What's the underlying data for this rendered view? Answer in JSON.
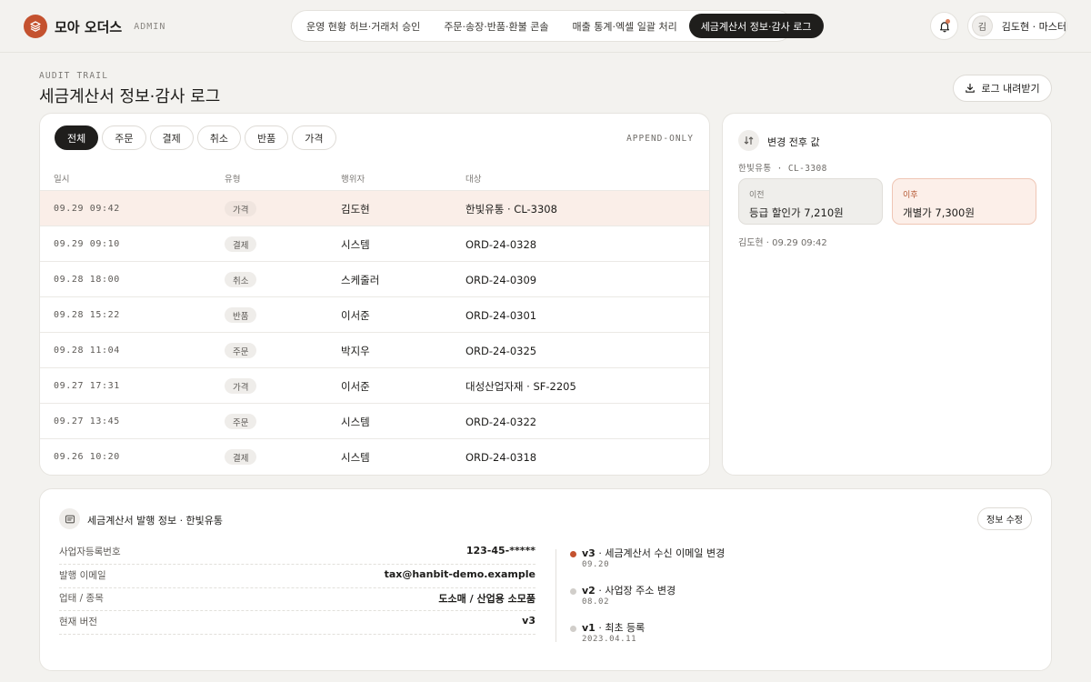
{
  "brand": {
    "name": "모아 오더스",
    "tag": "ADMIN",
    "color": "#c4522f"
  },
  "nav": {
    "tabs": [
      {
        "label": "운영 현황 허브·거래처 승인",
        "active": false
      },
      {
        "label": "주문·송장·반품·환불 콘솔",
        "active": false
      },
      {
        "label": "매출 통계·엑셀 일괄 처리",
        "active": false
      },
      {
        "label": "세금계산서 정보·감사 로그",
        "active": true
      }
    ]
  },
  "header": {
    "notification_icon": "bell-icon",
    "user": {
      "initial": "김",
      "name": "김도현 · 마스터"
    }
  },
  "page": {
    "eyebrow": "AUDIT TRAIL",
    "title": "세금계산서 정보·감사 로그",
    "download_label": "로그 내려받기"
  },
  "log": {
    "filters": [
      {
        "label": "전체",
        "active": true
      },
      {
        "label": "주문",
        "active": false
      },
      {
        "label": "결제",
        "active": false
      },
      {
        "label": "취소",
        "active": false
      },
      {
        "label": "반품",
        "active": false
      },
      {
        "label": "가격",
        "active": false
      }
    ],
    "mode": "APPEND-ONLY",
    "columns": {
      "time": "일시",
      "type": "유형",
      "actor": "행위자",
      "target": "대상"
    },
    "rows": [
      {
        "time": "09.29 09:42",
        "type": "가격",
        "actor": "김도현",
        "target": "한빛유통 · CL-3308",
        "selected": true
      },
      {
        "time": "09.29 09:10",
        "type": "결제",
        "actor": "시스템",
        "target": "ORD-24-0328"
      },
      {
        "time": "09.28 18:00",
        "type": "취소",
        "actor": "스케줄러",
        "target": "ORD-24-0309"
      },
      {
        "time": "09.28 15:22",
        "type": "반품",
        "actor": "이서준",
        "target": "ORD-24-0301"
      },
      {
        "time": "09.28 11:04",
        "type": "주문",
        "actor": "박지우",
        "target": "ORD-24-0325"
      },
      {
        "time": "09.27 17:31",
        "type": "가격",
        "actor": "이서준",
        "target": "대성산업자재 · SF-2205"
      },
      {
        "time": "09.27 13:45",
        "type": "주문",
        "actor": "시스템",
        "target": "ORD-24-0322"
      },
      {
        "time": "09.26 10:20",
        "type": "결제",
        "actor": "시스템",
        "target": "ORD-24-0318"
      }
    ]
  },
  "diff": {
    "title": "변경 전후 값",
    "meta": "한빛유통 · CL-3308",
    "before": {
      "label": "이전",
      "value": "등급 할인가 7,210원"
    },
    "after": {
      "label": "이후",
      "value": "개별가 7,300원"
    },
    "footer": "김도현 · 09.29 09:42"
  },
  "tax": {
    "title": "세금계산서 발행 정보 · 한빛유통",
    "edit_label": "정보 수정",
    "fields": [
      {
        "key": "사업자등록번호",
        "value": "123-45-*****"
      },
      {
        "key": "발행 이메일",
        "value": "tax@hanbit-demo.example"
      },
      {
        "key": "업태 / 종목",
        "value": "도소매 / 산업용 소모품"
      },
      {
        "key": "현재 버전",
        "value": "v3"
      }
    ],
    "versions": [
      {
        "version": "v3",
        "desc": " · 세금계산서 수신 이메일 변경",
        "date": "09.20",
        "current": true
      },
      {
        "version": "v2",
        "desc": " · 사업장 주소 변경",
        "date": "08.02",
        "current": false
      },
      {
        "version": "v1",
        "desc": " · 최초 등록",
        "date": "2023.04.11",
        "current": false
      }
    ]
  }
}
